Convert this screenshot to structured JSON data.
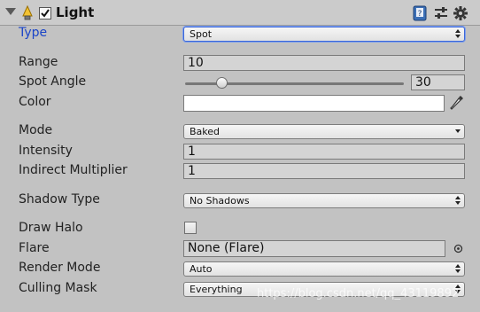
{
  "component": {
    "title": "Light",
    "enabled": true
  },
  "fields": {
    "type": {
      "label": "Type",
      "value": "Spot"
    },
    "range": {
      "label": "Range",
      "value": "10"
    },
    "spot_angle": {
      "label": "Spot Angle",
      "value": "30",
      "slider_fraction": 0.17
    },
    "color": {
      "label": "Color",
      "value_hex": "#ffffff"
    },
    "mode": {
      "label": "Mode",
      "value": "Baked"
    },
    "intensity": {
      "label": "Intensity",
      "value": "1"
    },
    "indirect_multiplier": {
      "label": "Indirect Multiplier",
      "value": "1"
    },
    "shadow_type": {
      "label": "Shadow Type",
      "value": "No Shadows"
    },
    "draw_halo": {
      "label": "Draw Halo",
      "checked": false
    },
    "flare": {
      "label": "Flare",
      "value": "None (Flare)"
    },
    "render_mode": {
      "label": "Render Mode",
      "value": "Auto"
    },
    "culling_mask": {
      "label": "Culling Mask",
      "value": "Everything"
    }
  },
  "icons": [
    "foldout-arrow-icon",
    "light-bulb-icon",
    "enable-checkbox-icon",
    "help-book-icon",
    "preset-sliders-icon",
    "gear-icon",
    "eyedropper-icon",
    "object-picker-icon"
  ],
  "watermark": "https://blog.csdn.net/qq_43119892",
  "colors": {
    "active_label": "#1b45c8",
    "panel_bg": "#c2c2c2",
    "focus_outline": "#3b66d8"
  }
}
